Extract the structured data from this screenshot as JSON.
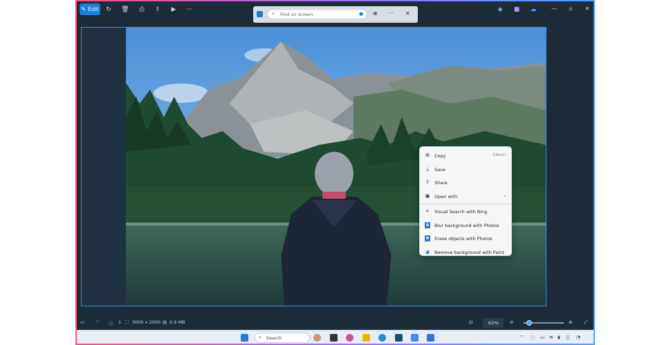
{
  "toolbar": {
    "edit_label": "Edit",
    "icons": [
      "rotate-icon",
      "delete-icon",
      "print-icon",
      "share-icon",
      "slideshow-icon",
      "more-icon"
    ]
  },
  "find": {
    "placeholder": "Find on screen"
  },
  "context_menu": {
    "items": [
      {
        "label": "Copy",
        "shortcut": "Ctrl+C",
        "icon": "copy-icon"
      },
      {
        "label": "Save",
        "icon": "save-icon"
      },
      {
        "label": "Share",
        "icon": "share-icon"
      },
      {
        "label": "Open with",
        "icon": "open-with-icon",
        "submenu": true
      },
      {
        "label": "Visual Search with Bing",
        "icon": "visual-search-icon"
      },
      {
        "label": "Blur background with Photos",
        "icon": "photos-icon"
      },
      {
        "label": "Erase objects with Photos",
        "icon": "photos-icon"
      },
      {
        "label": "Remove background with Paint",
        "icon": "paint-icon"
      }
    ]
  },
  "status": {
    "index": "1",
    "resolution": "3000 x 2000",
    "filesize": "6.9 MB",
    "zoom": "62%"
  },
  "taskbar": {
    "search_label": "Search"
  },
  "colors": {
    "accent": "#1a7fd6",
    "window_bg": "#1c2b38"
  }
}
